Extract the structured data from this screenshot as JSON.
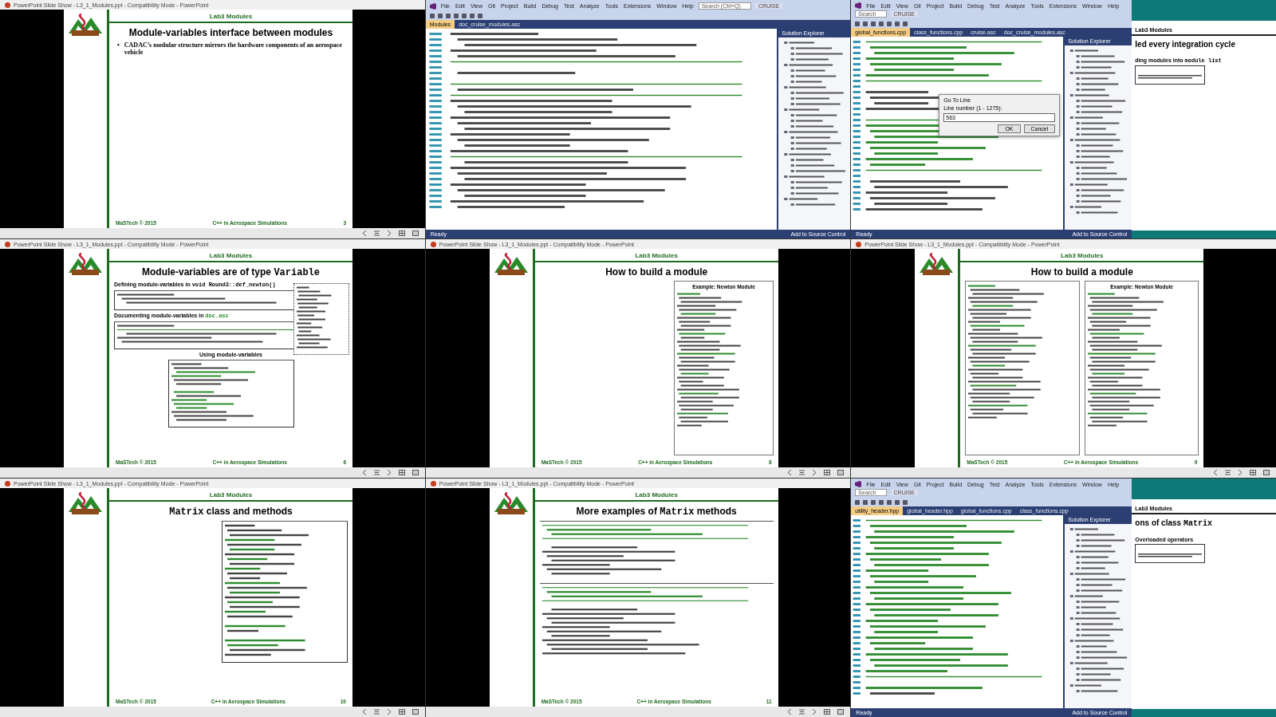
{
  "tiles": [
    {
      "kind": "slide",
      "caption": "PowerPoint Slide Show - L3_1_Modules.ppt - Compatibility Mode - PowerPoint",
      "slide": {
        "header": "Lab3 Modules",
        "title": [
          {
            "text": "Module-variables interface between modules",
            "kind": "plain"
          }
        ],
        "blocks": [
          {
            "kind": "bullet",
            "marker": "•",
            "text": "CADAC’s modular structure mirrors the hardware components of an aerospace vehicle"
          }
        ],
        "footer_left": "MaSTech © 2015",
        "footer_center": "C++ in Aerospace Simulations",
        "page": "3"
      }
    },
    {
      "kind": "ide",
      "ide": {
        "menu": [
          "File",
          "Edit",
          "View",
          "Git",
          "Project",
          "Build",
          "Debug",
          "Test",
          "Analyze",
          "Tools",
          "Extensions",
          "Window",
          "Help"
        ],
        "search": "Search (Ctrl+Q)",
        "solution": "CRUISE",
        "tabs": [
          {
            "label": "Modules",
            "selected": true
          },
          {
            "label": "doc_cruise_modules.asc",
            "selected": false
          }
        ],
        "code": [
          {
            "kind": "code"
          },
          {
            "kind": "code"
          },
          {
            "kind": "code"
          },
          {
            "kind": "code"
          },
          {
            "kind": "code"
          },
          {
            "kind": "rule"
          },
          {
            "kind": "blank"
          },
          {
            "kind": "code"
          },
          {
            "kind": "blank"
          },
          {
            "kind": "rule"
          },
          {
            "kind": "code"
          },
          {
            "kind": "rule"
          },
          {
            "kind": "code"
          },
          {
            "kind": "code"
          },
          {
            "kind": "code"
          },
          {
            "kind": "code"
          },
          {
            "kind": "code"
          },
          {
            "kind": "code"
          },
          {
            "kind": "code"
          },
          {
            "kind": "code"
          },
          {
            "kind": "code"
          },
          {
            "kind": "code"
          },
          {
            "kind": "rule"
          },
          {
            "kind": "code"
          },
          {
            "kind": "code"
          },
          {
            "kind": "code"
          },
          {
            "kind": "code"
          },
          {
            "kind": "code"
          },
          {
            "kind": "code"
          },
          {
            "kind": "code"
          },
          {
            "kind": "code"
          },
          {
            "kind": "code"
          }
        ],
        "explorer_title": "Solution Explorer",
        "status": "Ready",
        "source_control": "Add to Source Control"
      }
    },
    {
      "kind": "ide",
      "ide": {
        "menu": [
          "File",
          "Edit",
          "View",
          "Git",
          "Project",
          "Build",
          "Debug",
          "Test",
          "Analyze",
          "Tools",
          "Extensions",
          "Window",
          "Help"
        ],
        "search": "Search",
        "solution": "CRUISE",
        "tabs": [
          {
            "label": "global_functions.cpp",
            "selected": true
          },
          {
            "label": "class_functions.cpp",
            "selected": false
          },
          {
            "label": "cruise.asc",
            "selected": false
          },
          {
            "label": "doc_cruise_modules.asc",
            "selected": false
          }
        ],
        "code": [
          {
            "kind": "rule"
          },
          {
            "kind": "comment"
          },
          {
            "kind": "comment"
          },
          {
            "kind": "comment"
          },
          {
            "kind": "comment"
          },
          {
            "kind": "comment"
          },
          {
            "kind": "comment"
          },
          {
            "kind": "rule"
          },
          {
            "kind": "blank"
          },
          {
            "kind": "code"
          },
          {
            "kind": "code"
          },
          {
            "kind": "code"
          },
          {
            "kind": "code"
          },
          {
            "kind": "blank"
          },
          {
            "kind": "rule"
          },
          {
            "kind": "comment"
          },
          {
            "kind": "comment"
          },
          {
            "kind": "comment"
          },
          {
            "kind": "comment"
          },
          {
            "kind": "comment"
          },
          {
            "kind": "comment"
          },
          {
            "kind": "comment"
          },
          {
            "kind": "comment"
          },
          {
            "kind": "rule"
          },
          {
            "kind": "blank"
          },
          {
            "kind": "code"
          },
          {
            "kind": "code"
          },
          {
            "kind": "code"
          },
          {
            "kind": "code"
          },
          {
            "kind": "code"
          },
          {
            "kind": "code"
          }
        ],
        "explorer_title": "Solution Explorer",
        "status": "Ready",
        "source_control": "Add to Source Control",
        "dialog": {
          "title": "Go To Line",
          "label": "Line number (1 - 1275):",
          "value": "563",
          "buttons": [
            "OK",
            "Cancel"
          ]
        },
        "side_slide": {
          "header": "Lab3 Modules",
          "title": [
            {
              "text": "led every integration cycle",
              "kind": "plain"
            }
          ],
          "note": [
            {
              "text": "ding modules into ",
              "kind": "plain"
            },
            {
              "text": "module list",
              "kind": "code"
            }
          ]
        }
      }
    },
    {
      "kind": "slide",
      "caption": "PowerPoint Slide Show - L3_1_Modules.ppt - Compatibility Mode - PowerPoint",
      "slide": {
        "header": "Lab3 Modules",
        "title": [
          {
            "text": "Module-variables are of type ",
            "kind": "plain"
          },
          {
            "text": "Variable",
            "kind": "code"
          }
        ],
        "blocks": [
          {
            "kind": "label",
            "parts": [
              {
                "text": "Defining module-variables in ",
                "kind": "plain"
              },
              {
                "text": "void Round3::def_newton()",
                "kind": "code"
              }
            ]
          },
          {
            "kind": "listing_box",
            "lines": [
              {
                "kind": "code"
              },
              {
                "kind": "code"
              },
              {
                "kind": "code"
              }
            ]
          },
          {
            "kind": "label",
            "parts": [
              {
                "text": "Documenting module-variables in ",
                "kind": "plain"
              },
              {
                "text": "doc.asc",
                "kind": "comment"
              }
            ]
          },
          {
            "kind": "listing_box",
            "lines": [
              {
                "kind": "code"
              },
              {
                "kind": "rule"
              },
              {
                "kind": "code"
              },
              {
                "kind": "code"
              },
              {
                "kind": "code"
              }
            ]
          },
          {
            "kind": "label",
            "parts": [
              {
                "text": "Using module-variables",
                "kind": "plain"
              }
            ]
          },
          {
            "kind": "listing_box_center",
            "lines": [
              {
                "kind": "code"
              },
              {
                "kind": "code"
              },
              {
                "kind": "comment"
              },
              {
                "kind": "comment"
              },
              {
                "kind": "code"
              },
              {
                "kind": "code"
              },
              {
                "kind": "blank"
              },
              {
                "kind": "comment"
              },
              {
                "kind": "code"
              },
              {
                "kind": "comment"
              },
              {
                "kind": "comment"
              },
              {
                "kind": "comment"
              },
              {
                "kind": "code"
              },
              {
                "kind": "code"
              },
              {
                "kind": "code"
              }
            ]
          },
          {
            "kind": "callout",
            "lines": [
              {
                "kind": "code"
              },
              {
                "kind": "code"
              },
              {
                "kind": "code"
              },
              {
                "kind": "code"
              },
              {
                "kind": "code"
              },
              {
                "kind": "code"
              },
              {
                "kind": "code"
              },
              {
                "kind": "code"
              },
              {
                "kind": "code"
              },
              {
                "kind": "code"
              },
              {
                "kind": "code"
              },
              {
                "kind": "code"
              },
              {
                "kind": "code"
              },
              {
                "kind": "code"
              },
              {
                "kind": "code"
              },
              {
                "kind": "code"
              }
            ]
          }
        ],
        "footer_left": "MaSTech © 2015",
        "footer_center": "C++ in Aerospace Simulations",
        "page": "6"
      }
    },
    {
      "kind": "slide",
      "caption": "PowerPoint Slide Show - L3_1_Modules.ppt - Compatibility Mode - PowerPoint",
      "slide": {
        "header": "Lab3 Modules",
        "title": [
          {
            "text": "How to build a module",
            "kind": "plain"
          }
        ],
        "blocks": [
          {
            "kind": "doc_panel",
            "heading": "Example: Newton Module"
          }
        ],
        "footer_left": "MaSTech © 2015",
        "footer_center": "C++ in Aerospace Simulations",
        "page": "8"
      }
    },
    {
      "kind": "slide",
      "caption": "PowerPoint Slide Show - L3_1_Modules.ppt - Compatibility Mode - PowerPoint",
      "slide": {
        "header": "Lab3 Modules",
        "title": [
          {
            "text": "How to build a module",
            "kind": "plain"
          }
        ],
        "blocks": [
          {
            "kind": "doc_panels",
            "heading": "Example: Newton Module"
          }
        ],
        "footer_left": "MaSTech © 2015",
        "footer_center": "C++ in Aerospace Simulations",
        "page": "9"
      }
    },
    {
      "kind": "slide",
      "caption": "PowerPoint Slide Show - L3_1_Modules.ppt - Compatibility Mode - PowerPoint",
      "slide": {
        "header": "Lab3 Modules",
        "title": [
          {
            "text": "Matrix",
            "kind": "code"
          },
          {
            "text": " class and methods",
            "kind": "plain"
          }
        ],
        "blocks": [
          {
            "kind": "listing_box_right",
            "lines": [
              {
                "kind": "code"
              },
              {
                "kind": "code"
              },
              {
                "kind": "code"
              },
              {
                "kind": "comment"
              },
              {
                "kind": "code"
              },
              {
                "kind": "comment"
              },
              {
                "kind": "code"
              },
              {
                "kind": "comment"
              },
              {
                "kind": "code"
              },
              {
                "kind": "comment"
              },
              {
                "kind": "code"
              },
              {
                "kind": "code"
              },
              {
                "kind": "comment"
              },
              {
                "kind": "code"
              },
              {
                "kind": "comment"
              },
              {
                "kind": "code"
              },
              {
                "kind": "comment"
              },
              {
                "kind": "code"
              },
              {
                "kind": "comment"
              },
              {
                "kind": "code"
              },
              {
                "kind": "blank"
              },
              {
                "kind": "comment"
              },
              {
                "kind": "code"
              },
              {
                "kind": "blank"
              },
              {
                "kind": "comment"
              },
              {
                "kind": "comment"
              },
              {
                "kind": "code"
              },
              {
                "kind": "code"
              }
            ]
          }
        ],
        "footer_left": "MaSTech © 2015",
        "footer_center": "C++ in Aerospace Simulations",
        "page": "10"
      }
    },
    {
      "kind": "slide",
      "caption": "PowerPoint Slide Show - L3_1_Modules.ppt - Compatibility Mode - PowerPoint",
      "slide": {
        "header": "Lab3 Modules",
        "title": [
          {
            "text": "More examples of ",
            "kind": "plain"
          },
          {
            "text": "Matrix",
            "kind": "code"
          },
          {
            "text": " methods",
            "kind": "plain"
          }
        ],
        "blocks": [
          {
            "kind": "listing_open",
            "lines": [
              {
                "kind": "rule"
              },
              {
                "kind": "comment"
              },
              {
                "kind": "comment"
              },
              {
                "kind": "rule"
              },
              {
                "kind": "blank"
              },
              {
                "kind": "code"
              },
              {
                "kind": "code"
              },
              {
                "kind": "code"
              },
              {
                "kind": "code"
              },
              {
                "kind": "code"
              },
              {
                "kind": "code"
              },
              {
                "kind": "code"
              }
            ]
          },
          {
            "kind": "listing_open",
            "lines": [
              {
                "kind": "rule"
              },
              {
                "kind": "comment"
              },
              {
                "kind": "comment"
              },
              {
                "kind": "rule"
              },
              {
                "kind": "blank"
              },
              {
                "kind": "code"
              },
              {
                "kind": "code"
              },
              {
                "kind": "code"
              },
              {
                "kind": "code"
              },
              {
                "kind": "code"
              },
              {
                "kind": "code"
              },
              {
                "kind": "code"
              },
              {
                "kind": "code"
              },
              {
                "kind": "code"
              },
              {
                "kind": "code"
              },
              {
                "kind": "code"
              }
            ]
          }
        ],
        "footer_left": "MaSTech © 2015",
        "footer_center": "C++ in Aerospace Simulations",
        "page": "11"
      }
    },
    {
      "kind": "ide",
      "ide": {
        "menu": [
          "File",
          "Edit",
          "View",
          "Git",
          "Project",
          "Build",
          "Debug",
          "Test",
          "Analyze",
          "Tools",
          "Extensions",
          "Window",
          "Help"
        ],
        "search": "Search",
        "solution": "CRUISE",
        "tabs": [
          {
            "label": "utility_header.hpp",
            "selected": true
          },
          {
            "label": "global_header.hpp",
            "selected": false
          },
          {
            "label": "global_functions.cpp",
            "selected": false
          },
          {
            "label": "class_functions.cpp",
            "selected": false
          }
        ],
        "code": [
          {
            "kind": "rule"
          },
          {
            "kind": "comment"
          },
          {
            "kind": "comment"
          },
          {
            "kind": "comment"
          },
          {
            "kind": "comment"
          },
          {
            "kind": "comment"
          },
          {
            "kind": "comment"
          },
          {
            "kind": "comment"
          },
          {
            "kind": "comment"
          },
          {
            "kind": "comment"
          },
          {
            "kind": "comment"
          },
          {
            "kind": "comment"
          },
          {
            "kind": "comment"
          },
          {
            "kind": "comment"
          },
          {
            "kind": "comment"
          },
          {
            "kind": "comment"
          },
          {
            "kind": "comment"
          },
          {
            "kind": "comment"
          },
          {
            "kind": "comment"
          },
          {
            "kind": "comment"
          },
          {
            "kind": "comment"
          },
          {
            "kind": "comment"
          },
          {
            "kind": "comment"
          },
          {
            "kind": "comment"
          },
          {
            "kind": "comment"
          },
          {
            "kind": "comment"
          },
          {
            "kind": "comment"
          },
          {
            "kind": "comment"
          },
          {
            "kind": "rule"
          },
          {
            "kind": "blank"
          },
          {
            "kind": "comment"
          },
          {
            "kind": "code"
          }
        ],
        "explorer_title": "Solution Explorer",
        "status": "Ready",
        "source_control": "Add to Source Control",
        "side_slide": {
          "header": "Lab3 Modules",
          "title": [
            {
              "text": "ons of class ",
              "kind": "plain"
            },
            {
              "text": "Matrix",
              "kind": "code"
            }
          ],
          "note": [
            {
              "text": "Overloaded operators",
              "kind": "plain"
            }
          ]
        }
      }
    }
  ]
}
